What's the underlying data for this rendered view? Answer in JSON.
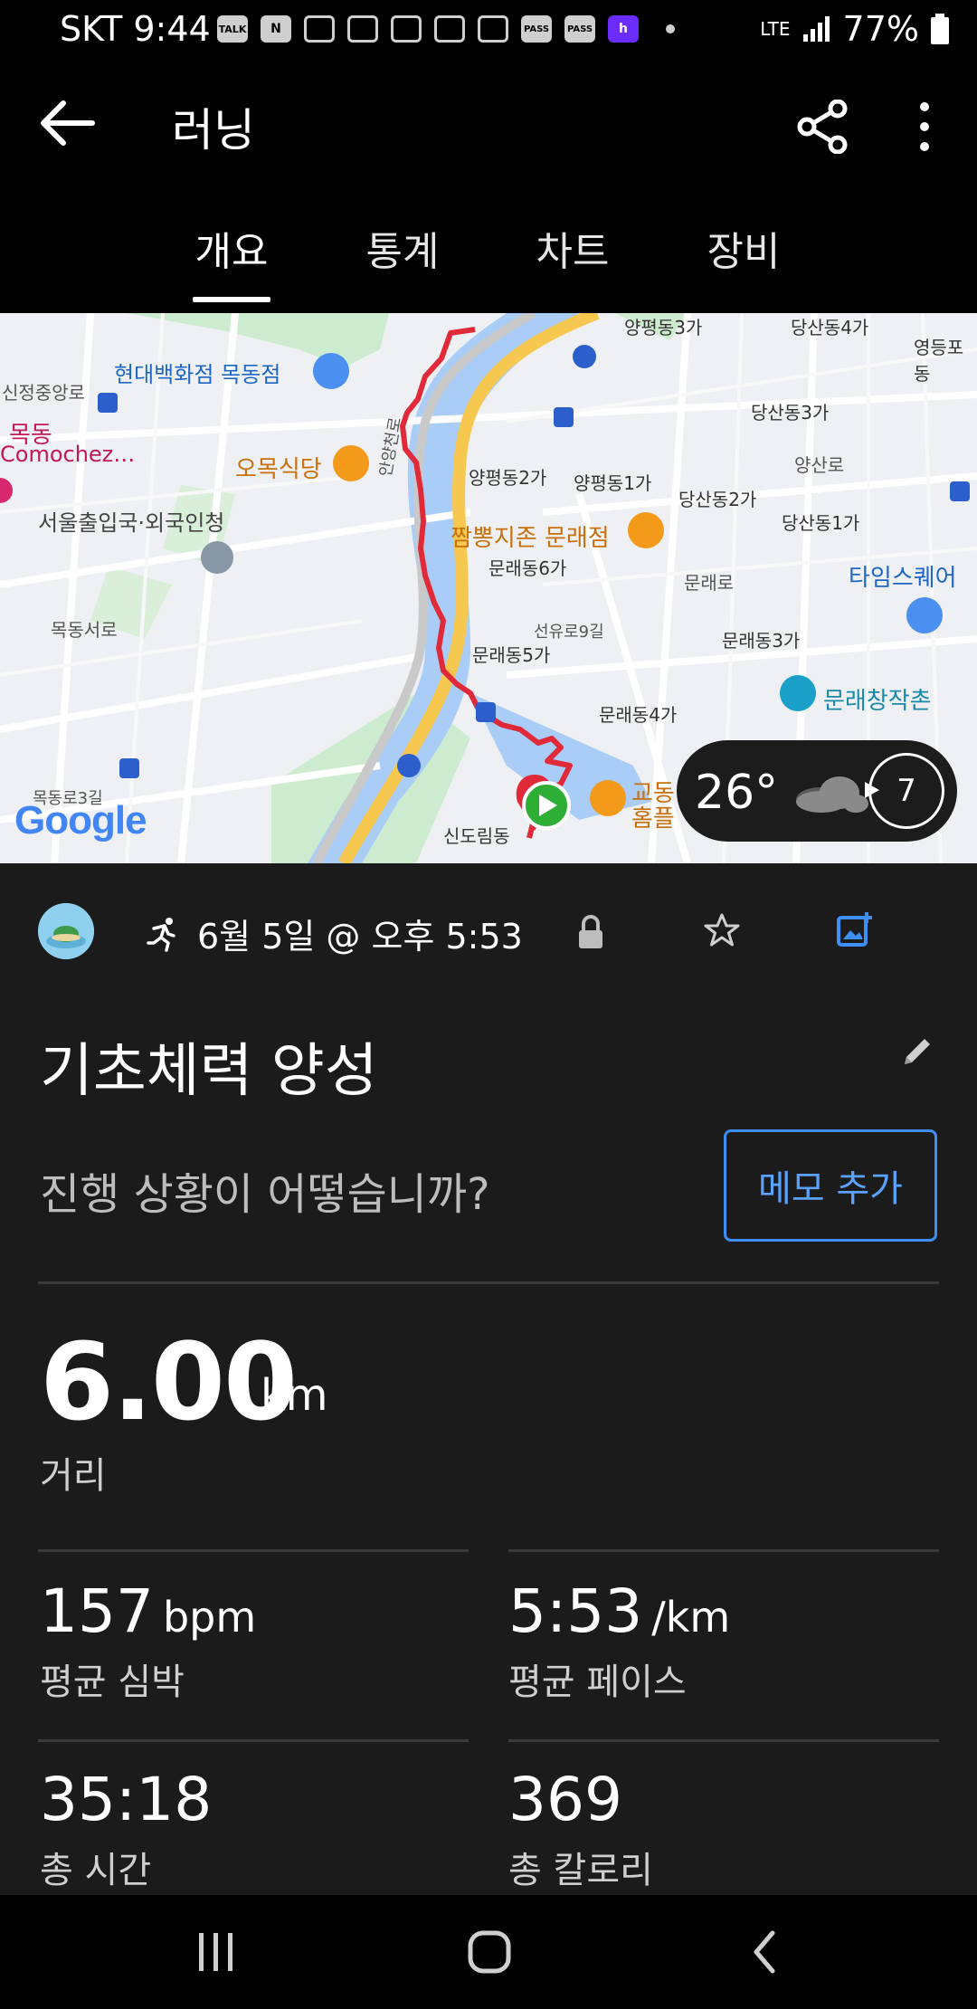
{
  "status_bar": {
    "carrier_time": "SKT 9:44",
    "network": "LTE",
    "battery": "77%",
    "notif_icons": [
      "TALK",
      "N",
      "PASS",
      "PASS",
      "h"
    ]
  },
  "app_bar": {
    "title": "러닝"
  },
  "tabs": [
    {
      "label": "개요",
      "active": true
    },
    {
      "label": "통계",
      "active": false
    },
    {
      "label": "차트",
      "active": false
    },
    {
      "label": "장비",
      "active": false
    }
  ],
  "map": {
    "google_logo": "Google",
    "labels": {
      "l1": "현대백화점 목동점",
      "l2": "신정중앙로",
      "l3": "목동",
      "l4": "Comochez…",
      "l5": "오목식당",
      "l6": "서울출입국·외국인청",
      "l7": "양평동2가",
      "l8": "양평동1가",
      "l9": "당산동2가",
      "l10": "당산동3가",
      "l11": "당산동4가",
      "l12": "양평동3가",
      "l13": "짬뽕지존 문래점",
      "l14": "문래동6가",
      "l15": "당산동1가",
      "l16": "타임스퀘어",
      "l17": "선유로9길",
      "l18": "문래동5가",
      "l19": "문래동3가",
      "l20": "문래동4가",
      "l21": "문래창작촌",
      "l22": "목동로3길",
      "l23": "신도림동",
      "l24": "교동",
      "l25": "홈플",
      "l26": "영등포동",
      "l27": "양산로",
      "l28": "문래로",
      "l29": "안양천로",
      "l30": "목동서로"
    }
  },
  "weather": {
    "temperature": "26°",
    "wind_speed": "7"
  },
  "activity": {
    "date_time": "6월 5일 @ 오후 5:53",
    "title": "기초체력 양성",
    "prompt": "진행 상황이 어떻습니까?",
    "memo_button": "메모 추가"
  },
  "stats": {
    "distance": {
      "value": "6.00",
      "unit": "km",
      "label": "거리"
    },
    "heart_rate": {
      "value": "157",
      "unit": "bpm",
      "label": "평균 심박"
    },
    "pace": {
      "value": "5:53",
      "unit": "/km",
      "label": "평균 페이스"
    },
    "total_time": {
      "value": "35:18",
      "label": "총 시간"
    },
    "calories": {
      "value": "369",
      "label": "총 칼로리"
    }
  },
  "colors": {
    "route": "#e02a3a",
    "accent_blue": "#3e8ef7",
    "map_water": "#a9cdf7",
    "map_park": "#cdeccf",
    "map_highway": "#f7c850"
  }
}
